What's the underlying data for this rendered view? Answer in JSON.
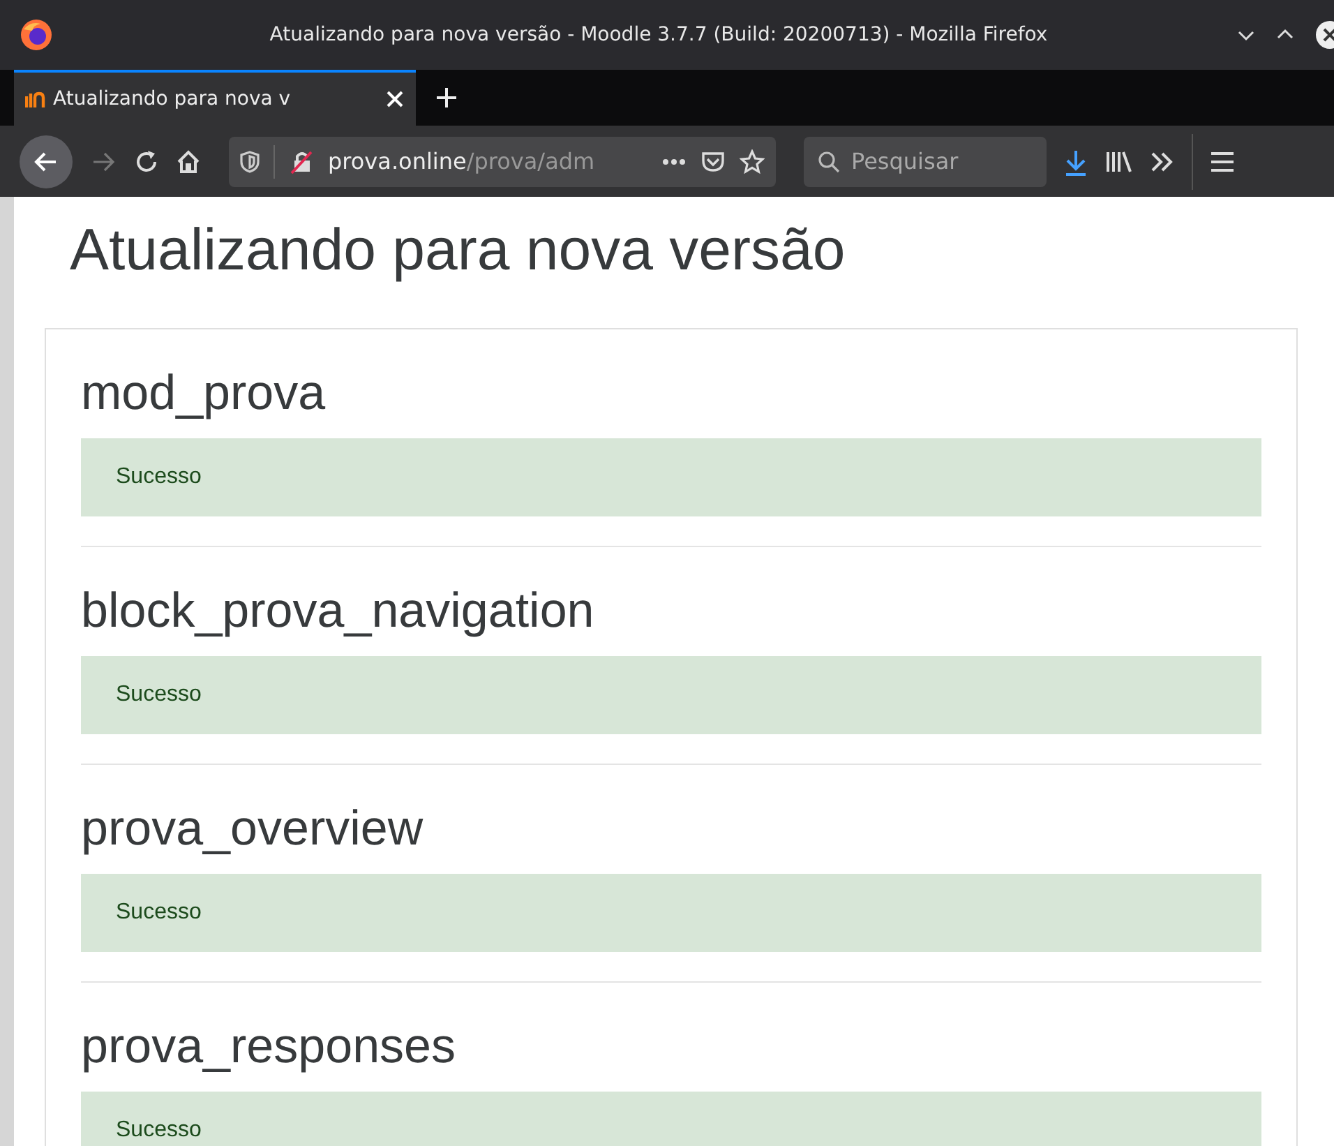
{
  "window": {
    "title": "Atualizando para nova versão - Moodle 3.7.7 (Build: 20200713) - Mozilla Firefox"
  },
  "tabs": [
    {
      "label": "Atualizando para nova v",
      "selected": true
    }
  ],
  "address_bar": {
    "host": "prova.online",
    "path": "/prova/adm"
  },
  "search": {
    "placeholder": "Pesquisar"
  },
  "page": {
    "heading": "Atualizando para nova versão",
    "sections": [
      {
        "name": "mod_prova",
        "status": "Sucesso"
      },
      {
        "name": "block_prova_navigation",
        "status": "Sucesso"
      },
      {
        "name": "prova_overview",
        "status": "Sucesso"
      },
      {
        "name": "prova_responses",
        "status": "Sucesso"
      }
    ]
  }
}
